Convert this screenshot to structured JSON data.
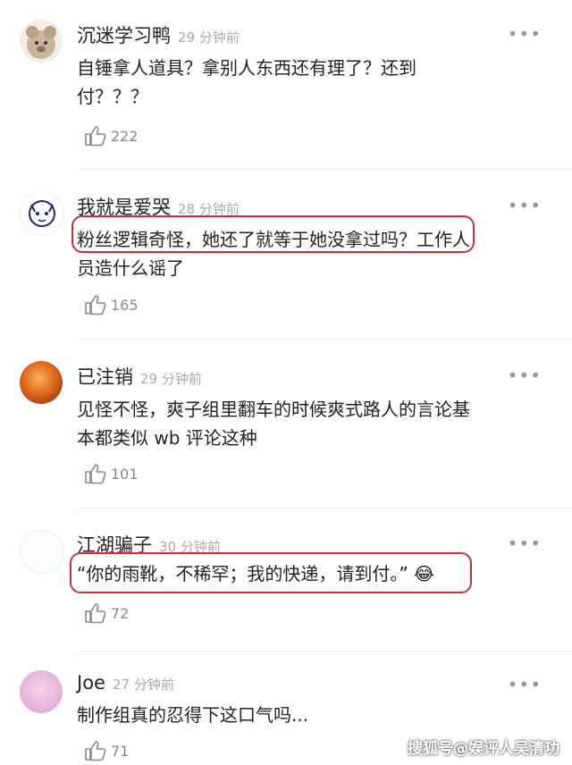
{
  "comments": [
    {
      "user": "沉迷学习鸭",
      "time": "29 分钟前",
      "line1": "自锤拿人道具？拿别人东西还有理了？还到",
      "line2": "付？？？",
      "likes": "222"
    },
    {
      "user": "我就是爱哭",
      "time": "28 分钟前",
      "line1": "粉丝逻辑奇怪，她还了就等于她没拿过吗？工作人",
      "line2": "员造什么谣了",
      "likes": "165"
    },
    {
      "user": "已注销",
      "time": "29 分钟前",
      "line1": "见怪不怪，爽子组里翻车的时候爽式路人的言论基",
      "line2": "本都类似 wb 评论这种",
      "likes": "101"
    },
    {
      "user": "江湖骗子",
      "time": "30 分钟前",
      "line1": "“你的雨靴，不稀罕；我的快递，请到付。”",
      "emoji": "😂",
      "likes": "72"
    },
    {
      "user": "Joe",
      "time": "27 分钟前",
      "line1": "制作组真的忍得下这口气吗...",
      "likes": "71"
    }
  ],
  "more_icon": "•••",
  "watermark": "搜狐号@娱评人吴清功"
}
